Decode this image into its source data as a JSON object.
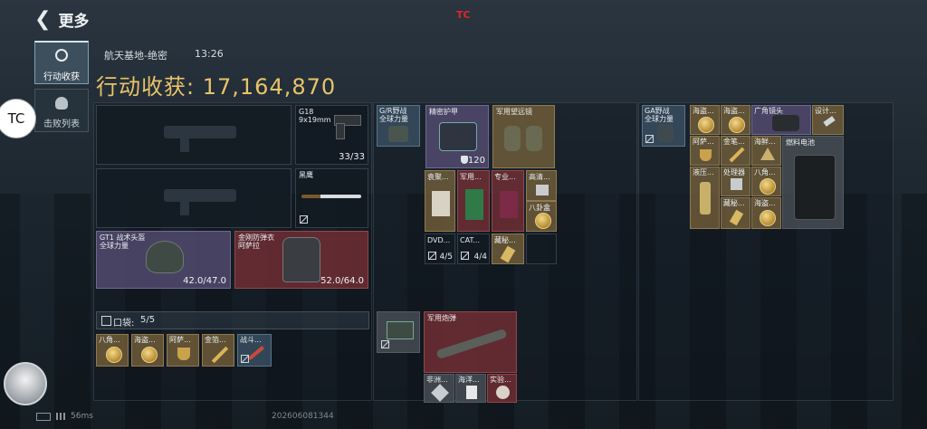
{
  "header": {
    "back_label": "更多",
    "watermark": "TC"
  },
  "side": {
    "tabs": [
      {
        "label": "行动收获",
        "active": true
      },
      {
        "label": "击败列表",
        "active": false
      }
    ],
    "float_badge": "TC"
  },
  "map": {
    "name": "航天基地-绝密",
    "time": "13:26"
  },
  "summary": {
    "label": "行动收获:",
    "value": "17,164,870"
  },
  "equipment": {
    "pistol": {
      "name": "G18",
      "caliber": "9x19mm",
      "ammo": "33/33"
    },
    "melee": {
      "name": "黑鹰"
    },
    "helmet": {
      "name": "GT1 战术头盔",
      "subtitle": "全球力量",
      "durability": "42.0/47.0"
    },
    "armor": {
      "name": "金刚防弹衣",
      "subtitle": "阿萨拉",
      "durability": "52.0/64.0"
    }
  },
  "pocket": {
    "label": "口袋:",
    "count": "5/5",
    "items": [
      {
        "label": "八角..."
      },
      {
        "label": "海盗..."
      },
      {
        "label": "阿萨..."
      },
      {
        "label": "金箔..."
      },
      {
        "label": "战斗..."
      }
    ]
  },
  "chest": {
    "rig": {
      "name": "G/R野战",
      "subtitle": "全球力量"
    },
    "items": [
      {
        "label": "精密护甲",
        "count": "120"
      },
      {
        "label": "军用望远镜"
      },
      {
        "label": "袁聚..."
      },
      {
        "label": "军用..."
      },
      {
        "label": "专业..."
      },
      {
        "label": "高清..."
      },
      {
        "label": "八卦盒"
      },
      {
        "label": "DVD...",
        "count": "4/5"
      },
      {
        "label": "CAT...",
        "count": "4/4"
      },
      {
        "label": "藏秘..."
      }
    ]
  },
  "backpack_mid": {
    "items": [
      {
        "label": "军用炮弹"
      },
      {
        "label": "非洲..."
      },
      {
        "label": "海洋..."
      },
      {
        "label": "实验..."
      }
    ]
  },
  "backpack": {
    "bag": {
      "name": "GA野战",
      "subtitle": "全球力量"
    },
    "items": [
      {
        "label": "海盗..."
      },
      {
        "label": "海盗..."
      },
      {
        "label": "广角镜头"
      },
      {
        "label": "设计..."
      },
      {
        "label": "阿萨..."
      },
      {
        "label": "金笔..."
      },
      {
        "label": "海鲜..."
      },
      {
        "label": "燃料电池"
      },
      {
        "label": "液压..."
      },
      {
        "label": "处理器"
      },
      {
        "label": "八角..."
      },
      {
        "label": "海盗..."
      },
      {
        "label": "藏秘..."
      },
      {
        "label": "海盗..."
      }
    ]
  },
  "status": {
    "ping": "56ms",
    "build": "202606081344"
  },
  "colors": {
    "gold": "#e8c36a",
    "watermark": "#e0242a"
  }
}
